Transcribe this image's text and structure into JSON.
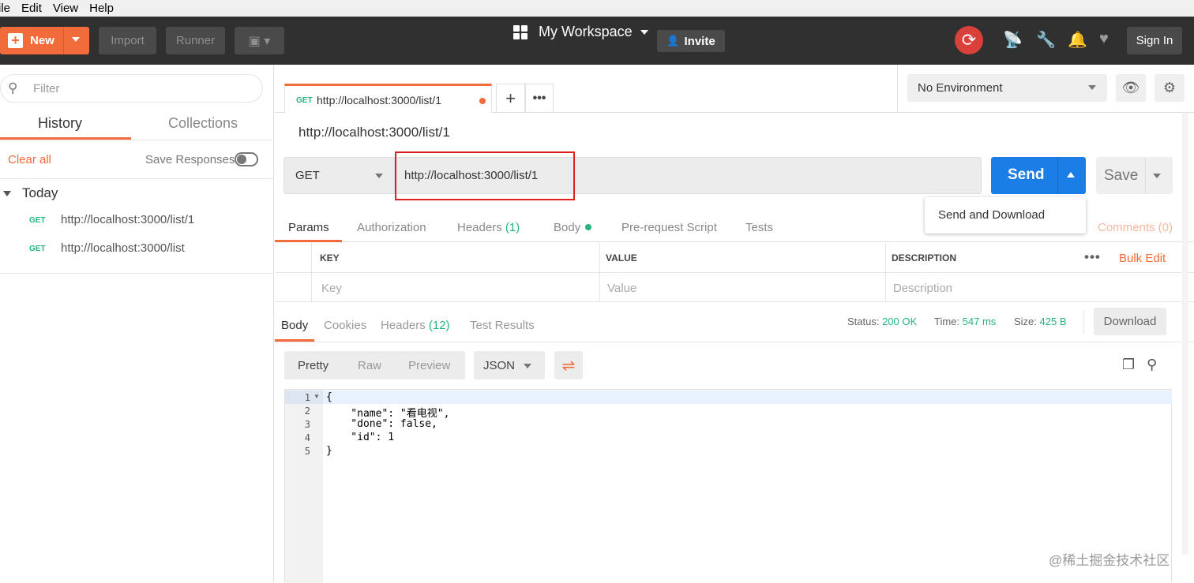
{
  "menubar": {
    "items": [
      "ile",
      "Edit",
      "View",
      "Help"
    ]
  },
  "toolbar": {
    "new_label": "New",
    "import_label": "Import",
    "runner_label": "Runner",
    "workspace_label": "My Workspace",
    "invite_label": "Invite",
    "signin_label": "Sign In"
  },
  "sidebar": {
    "filter_placeholder": "Filter",
    "tabs": [
      "History",
      "Collections"
    ],
    "clear_all": "Clear all",
    "save_responses": "Save Responses",
    "group_label": "Today",
    "history": [
      {
        "method": "GET",
        "url": "http://localhost:3000/list/1"
      },
      {
        "method": "GET",
        "url": "http://localhost:3000/list"
      }
    ]
  },
  "tab": {
    "method": "GET",
    "url": "http://localhost:3000/list/1"
  },
  "environment": {
    "selected": "No Environment"
  },
  "request": {
    "title": "http://localhost:3000/list/1",
    "method": "GET",
    "url": "http://localhost:3000/list/1",
    "send_label": "Send",
    "save_label": "Save",
    "dropdown_item": "Send and Download",
    "tabs": {
      "params": "Params",
      "authorization": "Authorization",
      "headers": "Headers",
      "headers_count": "(1)",
      "body": "Body",
      "prerequest": "Pre-request Script",
      "tests": "Tests",
      "comments": "Comments (0)"
    },
    "params_table": {
      "headers": [
        "KEY",
        "VALUE",
        "DESCRIPTION"
      ],
      "placeholders": [
        "Key",
        "Value",
        "Description"
      ],
      "bulk_edit": "Bulk Edit"
    }
  },
  "response": {
    "tabs": {
      "body": "Body",
      "cookies": "Cookies",
      "headers": "Headers",
      "headers_count": "(12)",
      "test_results": "Test Results"
    },
    "status_label": "Status:",
    "status_value": "200 OK",
    "time_label": "Time:",
    "time_value": "547 ms",
    "size_label": "Size:",
    "size_value": "425 B",
    "download_label": "Download",
    "view_modes": [
      "Pretty",
      "Raw",
      "Preview"
    ],
    "format": "JSON",
    "line_numbers": [
      "1",
      "2",
      "3",
      "4",
      "5"
    ],
    "code_lines": [
      "{",
      "    \"name\": \"看电视\",",
      "    \"done\": false,",
      "    \"id\": 1",
      "}"
    ]
  },
  "watermark": "@稀土掘金技术社区",
  "colors": {
    "accent": "#f26b3a",
    "send": "#1a7ee6",
    "success": "#26b47f",
    "highlight": "#e02020"
  }
}
